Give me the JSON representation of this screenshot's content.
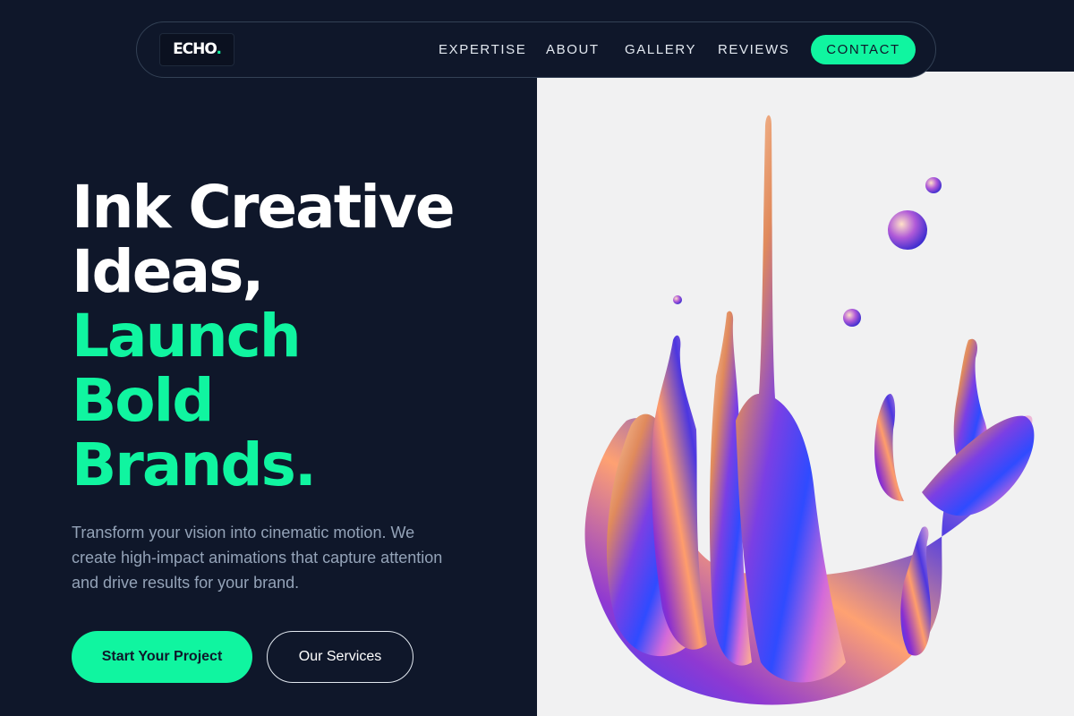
{
  "brand": {
    "name": "ECHO",
    "dot": "."
  },
  "nav": {
    "links": [
      "EXPERTISE",
      "ABOUT",
      "GALLERY",
      "REVIEWS"
    ],
    "cta": "CONTACT"
  },
  "hero": {
    "headline_white": [
      "Ink Creative",
      "Ideas,"
    ],
    "headline_green": [
      "Launch",
      "Bold",
      "Brands."
    ],
    "subtitle": "Transform your vision into cinematic motion. We create high-impact animations that capture attention and drive results for your brand.",
    "primary_cta": "Start Your Project",
    "secondary_cta": "Our Services",
    "image_description": "iridescent liquid splash sculpture"
  },
  "colors": {
    "background": "#0f172a",
    "accent": "#10f5a0",
    "panel": "#f1f1f2",
    "muted_text": "#94a3b8"
  }
}
